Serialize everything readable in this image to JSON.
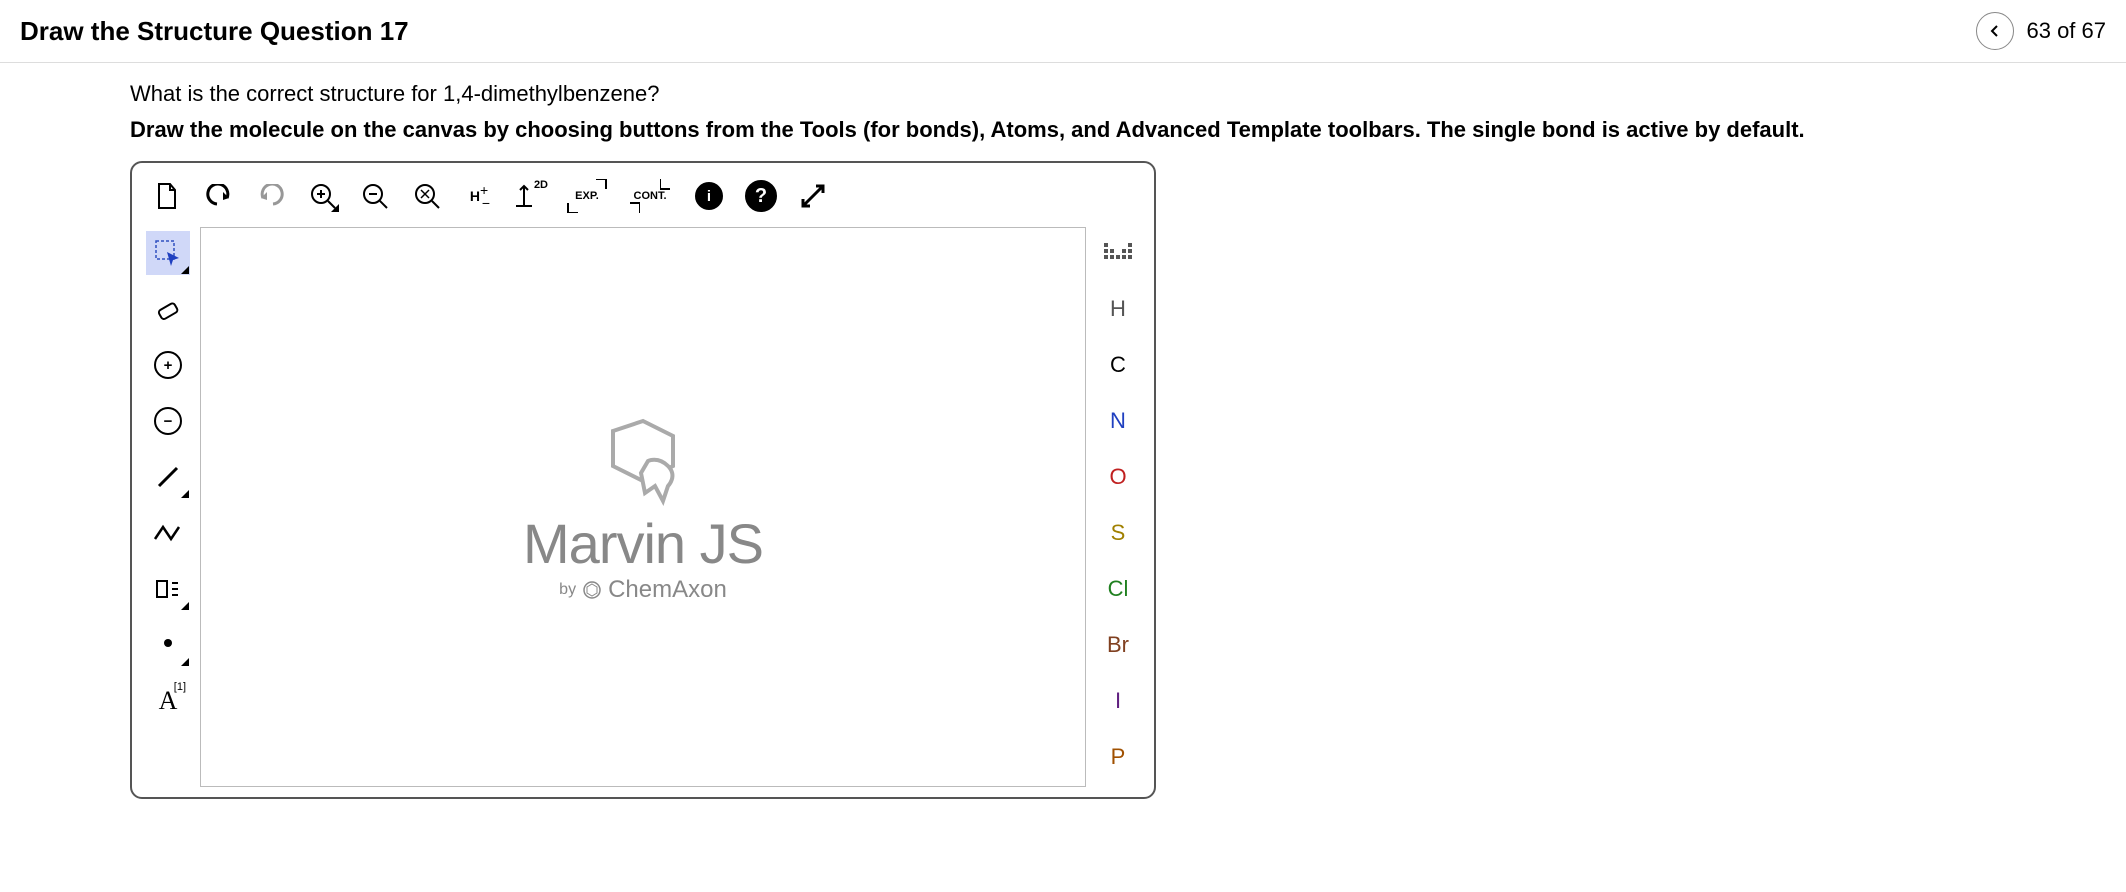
{
  "header": {
    "title": "Draw the Structure Question 17",
    "position": "63 of 67"
  },
  "question": "What is the correct structure for 1,4-dimethylbenzene?",
  "instruction": "Draw the molecule on the canvas by choosing buttons from the Tools (for bonds), Atoms, and Advanced Template toolbars. The single bond is active by default.",
  "top_toolbar": {
    "h_btn": "H",
    "twod_btn": "2D",
    "exp_btn": "EXP.",
    "cont_btn": "CONT."
  },
  "atoms": {
    "h": "H",
    "c": "C",
    "n": "N",
    "o": "O",
    "s": "S",
    "cl": "Cl",
    "br": "Br",
    "i": "I",
    "p": "P"
  },
  "left_toolbar": {
    "atom_label": "A",
    "atom_sup": "[1]"
  },
  "canvas": {
    "logo": "Marvin JS",
    "by": "by",
    "company": "ChemAxon"
  }
}
